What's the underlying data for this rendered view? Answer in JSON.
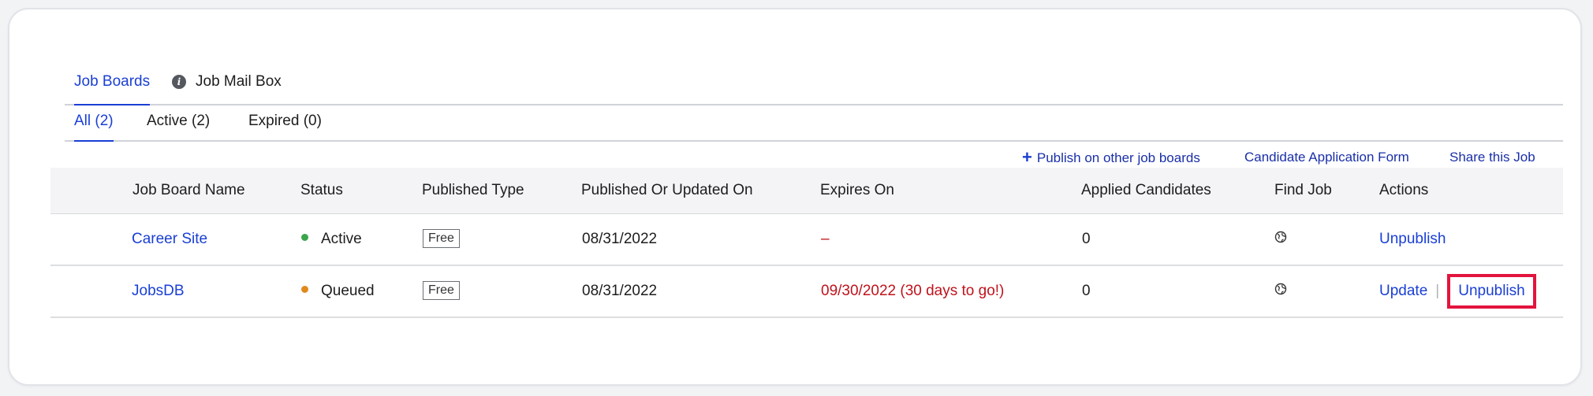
{
  "top_tabs": [
    {
      "label": "Job Boards",
      "active": true
    },
    {
      "label": "Job Mail Box",
      "active": false,
      "icon": "info-icon"
    }
  ],
  "filter_tabs": [
    {
      "label": "All (2)",
      "active": true
    },
    {
      "label": "Active (2)",
      "active": false
    },
    {
      "label": "Expired (0)",
      "active": false
    }
  ],
  "toolbar": {
    "publish_label": "Publish on other job boards",
    "application_form_label": "Candidate Application Form",
    "share_label": "Share this Job"
  },
  "table": {
    "headers": [
      "Job Board Name",
      "Status",
      "Published Type",
      "Published Or Updated On",
      "Expires On",
      "Applied Candidates",
      "Find Job",
      "Actions"
    ],
    "rows": [
      {
        "name": "Career Site",
        "status": "Active",
        "status_color": "#3aa54a",
        "published_type": "Free",
        "published_on": "08/31/2022",
        "expires_on": "–",
        "applied": "0",
        "find_job_icon": "globe-icon",
        "actions": [
          "Unpublish"
        ]
      },
      {
        "name": "JobsDB",
        "status": "Queued",
        "status_color": "#e08a1e",
        "published_type": "Free",
        "published_on": "08/31/2022",
        "expires_on": "09/30/2022 (30 days to go!)",
        "applied": "0",
        "find_job_icon": "globe-icon",
        "actions": [
          "Update",
          "Unpublish"
        ],
        "action_separator": "|"
      }
    ]
  },
  "colors": {
    "accent": "#1a3fd4",
    "expiry_red": "#c0121b",
    "highlight_box": "#e3143e"
  }
}
